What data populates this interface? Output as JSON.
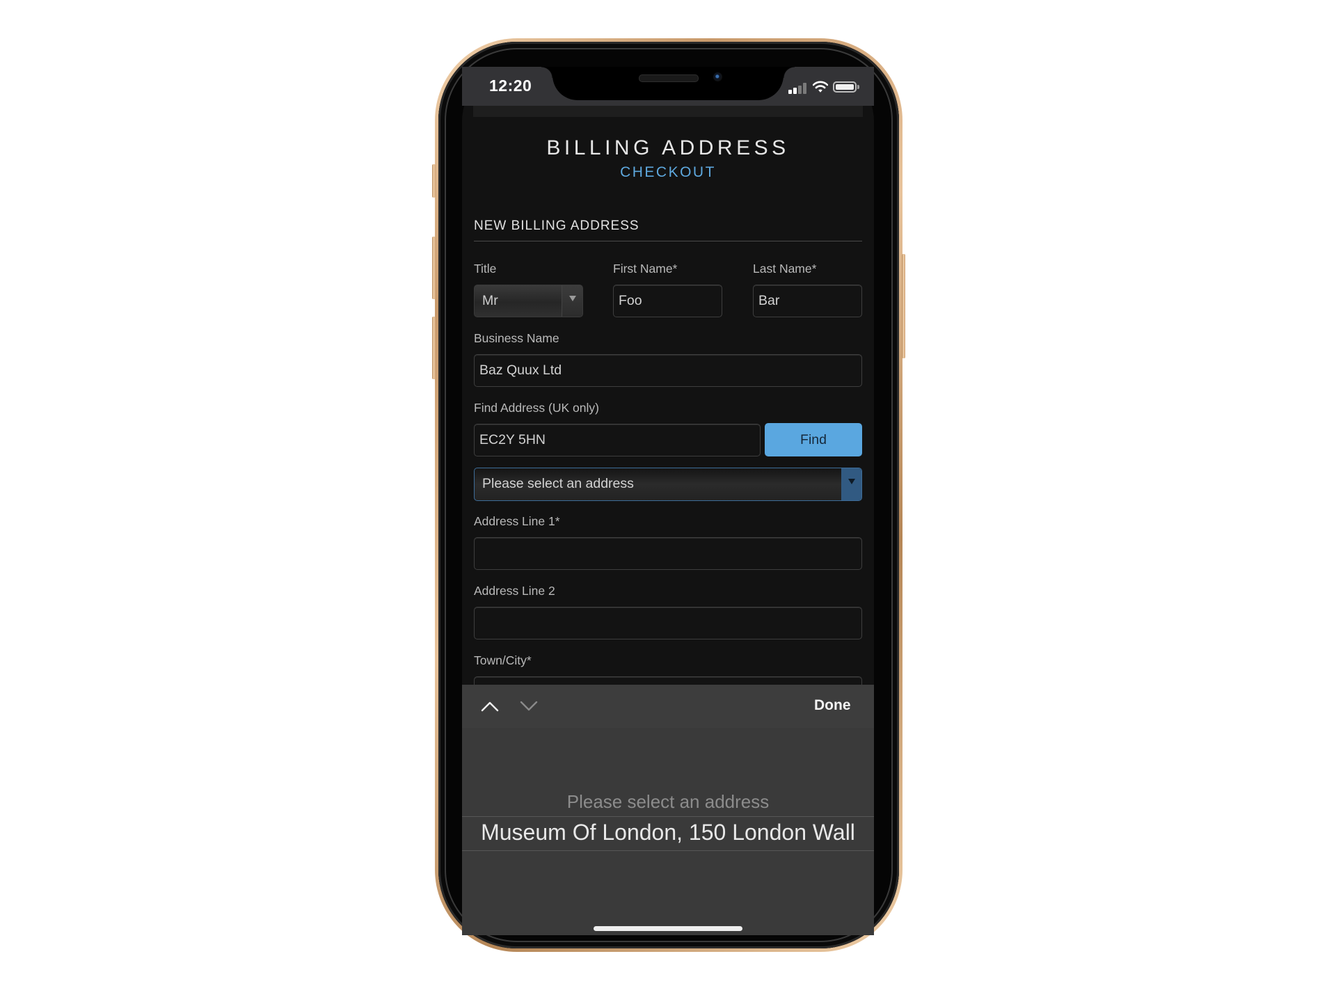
{
  "status_bar": {
    "time": "12:20",
    "signal_bars_active": 2,
    "signal_bars_total": 4,
    "icons": [
      "signal-icon",
      "wifi-icon",
      "battery-icon"
    ]
  },
  "header": {
    "title": "BILLING ADDRESS",
    "subtitle": "CHECKOUT",
    "subtitle_color": "#5ea8de"
  },
  "form": {
    "section_title": "NEW BILLING ADDRESS",
    "title_field": {
      "label": "Title",
      "value": "Mr"
    },
    "first_name": {
      "label": "First Name*",
      "value": "Foo"
    },
    "last_name": {
      "label": "Last Name*",
      "value": "Bar"
    },
    "business_name": {
      "label": "Business Name",
      "value": "Baz Quux Ltd"
    },
    "find_address": {
      "label": "Find Address (UK only)",
      "value": "EC2Y 5HN",
      "button_label": "Find",
      "button_color": "#5aa7e0"
    },
    "address_select": {
      "value": "Please select an address"
    },
    "address_line_1": {
      "label": "Address Line 1*",
      "value": ""
    },
    "address_line_2": {
      "label": "Address Line 2",
      "value": ""
    },
    "town_city": {
      "label": "Town/City*",
      "value": ""
    }
  },
  "keyboard_toolbar": {
    "prev_icon": "chevron-up-icon",
    "next_icon": "chevron-down-icon",
    "done_label": "Done"
  },
  "picker": {
    "options": [
      "Please select an address",
      "Museum Of London, 150 London Wall"
    ],
    "selected_index": 1
  }
}
